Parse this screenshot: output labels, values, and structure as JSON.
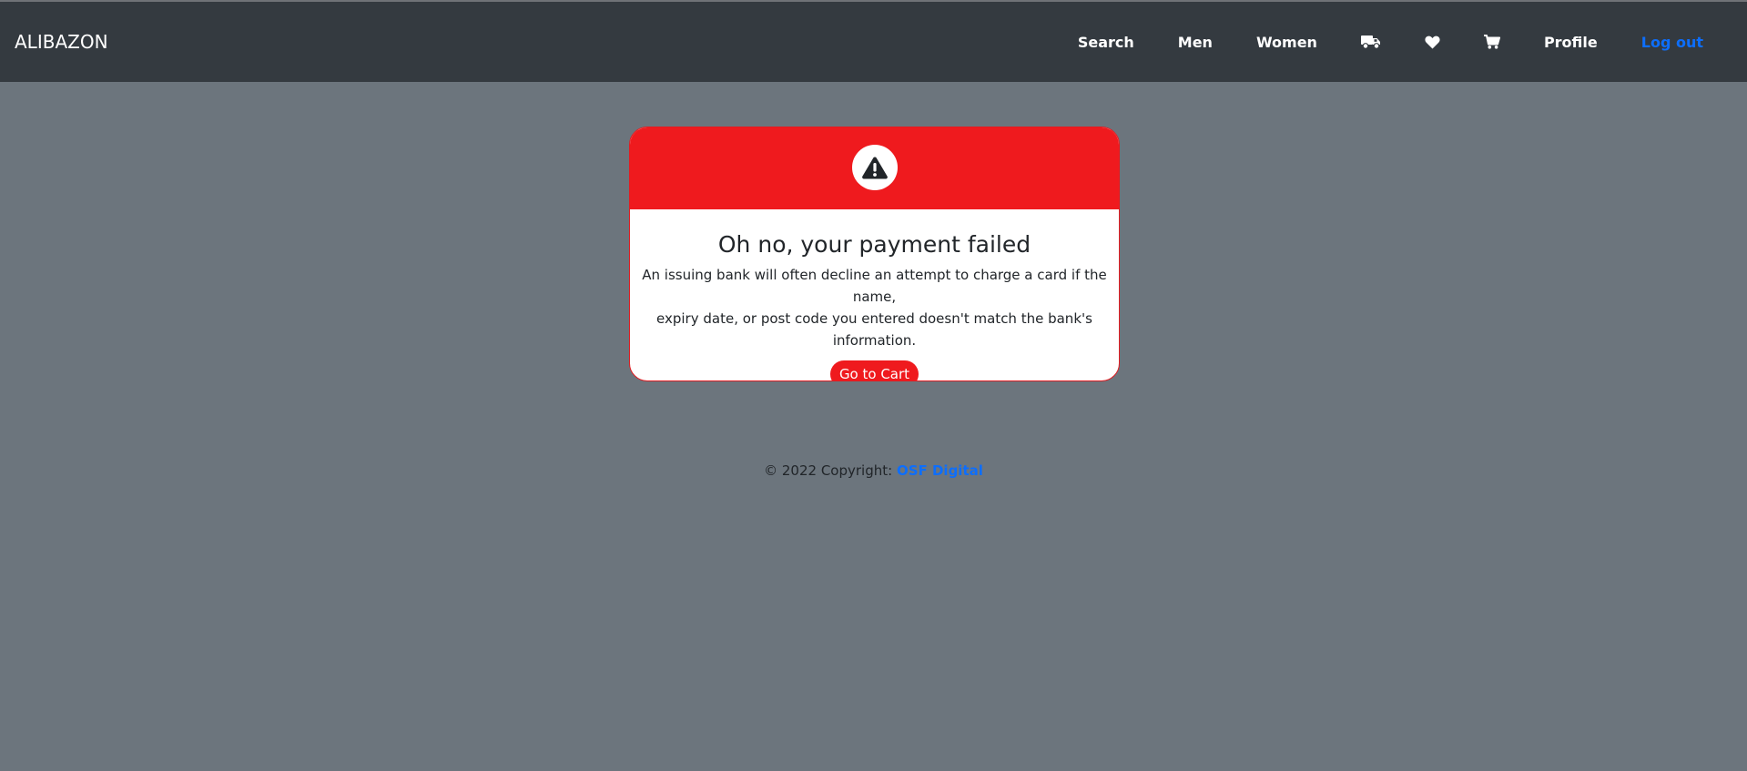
{
  "navbar": {
    "brand": "ALIBAZON",
    "links": {
      "search": "Search",
      "men": "Men",
      "women": "Women",
      "profile": "Profile",
      "logout": "Log out"
    },
    "icons": [
      "truck-icon",
      "heart-icon",
      "cart-icon"
    ],
    "colors": {
      "background": "#343a40",
      "logout": "#0d6efd"
    }
  },
  "payment_failed": {
    "icon": "warning-icon",
    "title": "Oh no, your payment failed",
    "message_line1": "An issuing bank will often decline an attempt to charge a card if the name,",
    "message_line2": "expiry date, or post code you entered doesn't match the bank's information.",
    "button_label": "Go to Cart",
    "colors": {
      "header": "#ef1a1e",
      "button": "#ef1a1e"
    }
  },
  "footer": {
    "copyright": "© 2022 Copyright:",
    "company": "OSF Digital"
  },
  "page": {
    "background": "#6c757d"
  }
}
